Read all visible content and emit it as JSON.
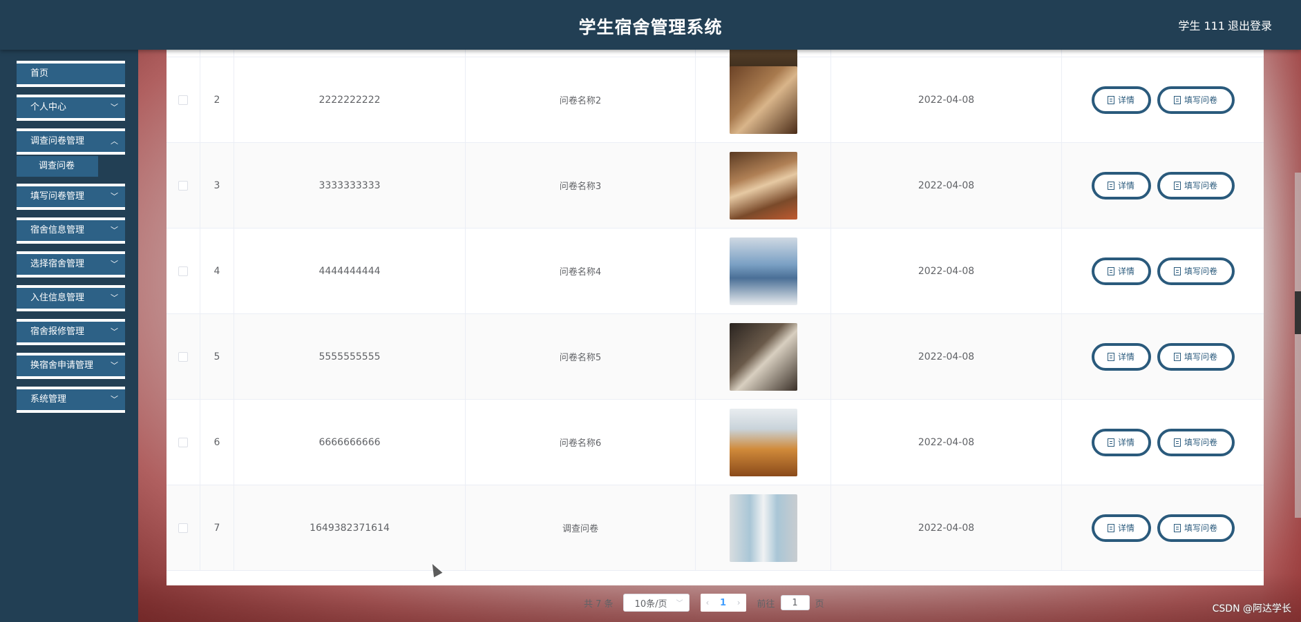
{
  "header": {
    "title": "学生宿舍管理系统",
    "user": "学生 111",
    "logout": "退出登录"
  },
  "sidebar": {
    "items": [
      {
        "label": "首页"
      },
      {
        "label": "个人中心"
      },
      {
        "label": "调查问卷管理"
      },
      {
        "label": "填写问卷管理"
      },
      {
        "label": "宿舍信息管理"
      },
      {
        "label": "选择宿舍管理"
      },
      {
        "label": "入住信息管理"
      },
      {
        "label": "宿舍报修管理"
      },
      {
        "label": "换宿舍申请管理"
      },
      {
        "label": "系统管理"
      }
    ],
    "subitem": "调查问卷"
  },
  "actions": {
    "detail": "详情",
    "fill": "填写问卷"
  },
  "table": {
    "rows": [
      {
        "index": "2",
        "number": "2222222222",
        "name": "问卷名称2",
        "date": "2022-04-08",
        "image": "dorm-photo-2"
      },
      {
        "index": "3",
        "number": "3333333333",
        "name": "问卷名称3",
        "date": "2022-04-08",
        "image": "dorm-photo-3"
      },
      {
        "index": "4",
        "number": "4444444444",
        "name": "问卷名称4",
        "date": "2022-04-08",
        "image": "dorm-photo-4"
      },
      {
        "index": "5",
        "number": "5555555555",
        "name": "问卷名称5",
        "date": "2022-04-08",
        "image": "dorm-photo-5"
      },
      {
        "index": "6",
        "number": "6666666666",
        "name": "问卷名称6",
        "date": "2022-04-08",
        "image": "dorm-photo-6"
      },
      {
        "index": "7",
        "number": "1649382371614",
        "name": "调查问卷",
        "date": "2022-04-08",
        "image": "dorm-photo-7"
      }
    ]
  },
  "pagination": {
    "total": "共 7 条",
    "page_size": "10条/页",
    "current": "1",
    "goto_prefix": "前往",
    "goto_value": "1",
    "goto_suffix": "页"
  },
  "watermark": "CSDN @阿达学长",
  "colors": {
    "header": "#223f54",
    "menu": "#2d6186",
    "button_border": "#2a5a7c"
  }
}
